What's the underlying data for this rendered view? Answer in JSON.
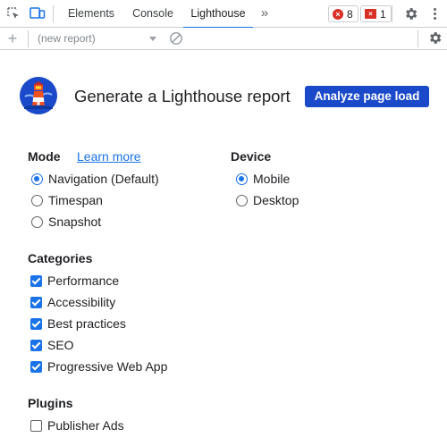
{
  "tabbar": {
    "icons": [
      "inspect-element-icon",
      "device-toolbar-icon"
    ],
    "tabs": [
      {
        "label": "Elements",
        "active": false
      },
      {
        "label": "Console",
        "active": false
      },
      {
        "label": "Lighthouse",
        "active": true
      }
    ],
    "more_tabs_glyph": "»",
    "errors_count": "8",
    "issues_count": "1",
    "error_color": "#d93025",
    "settings_icon": "gear-icon",
    "menu_icon": "kebab-menu-icon"
  },
  "toolbar": {
    "add_glyph": "+",
    "report_select_value": "(new report)",
    "clear_icon": "clear-icon",
    "settings_icon": "gear-icon"
  },
  "header": {
    "logo": "lighthouse-logo",
    "title": "Generate a Lighthouse report",
    "analyze_label": "Analyze page load",
    "accent_color": "#1a49c9"
  },
  "mode": {
    "heading": "Mode",
    "learn_more": "Learn more",
    "options": [
      {
        "label": "Navigation (Default)",
        "selected": true
      },
      {
        "label": "Timespan",
        "selected": false
      },
      {
        "label": "Snapshot",
        "selected": false
      }
    ]
  },
  "device": {
    "heading": "Device",
    "options": [
      {
        "label": "Mobile",
        "selected": true
      },
      {
        "label": "Desktop",
        "selected": false
      }
    ]
  },
  "categories": {
    "heading": "Categories",
    "items": [
      {
        "label": "Performance",
        "checked": true
      },
      {
        "label": "Accessibility",
        "checked": true
      },
      {
        "label": "Best practices",
        "checked": true
      },
      {
        "label": "SEO",
        "checked": true
      },
      {
        "label": "Progressive Web App",
        "checked": true
      }
    ]
  },
  "plugins": {
    "heading": "Plugins",
    "items": [
      {
        "label": "Publisher Ads",
        "checked": false
      }
    ]
  }
}
